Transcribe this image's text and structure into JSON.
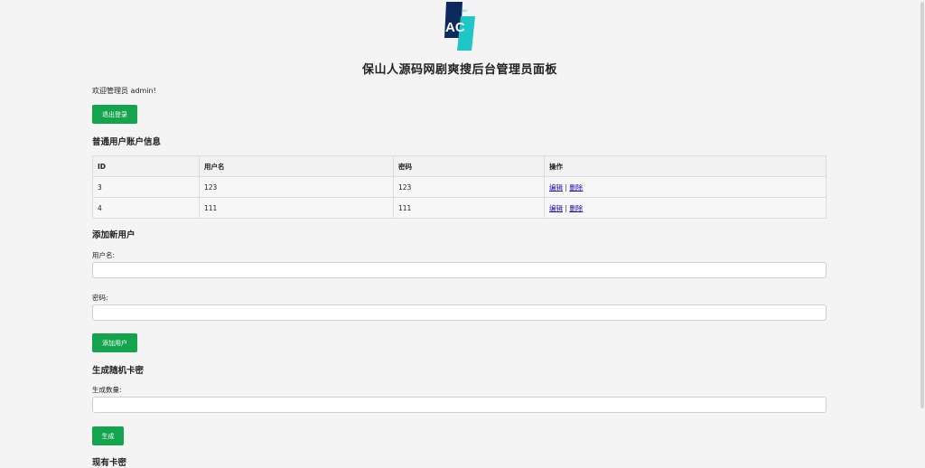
{
  "logo": {
    "text": "AC",
    "small_text": "AC"
  },
  "page_title": "保山人源码网剧爽搜后台管理员面板",
  "welcome": "欢迎管理员 admin!",
  "logout_button": "退出登录",
  "users_section": {
    "title": "普通用户账户信息",
    "columns": [
      "ID",
      "用户名",
      "密码",
      "操作"
    ],
    "rows": [
      {
        "id": "3",
        "username": "123",
        "password": "123",
        "edit": "编辑",
        "sep": "|",
        "delete": "删除"
      },
      {
        "id": "4",
        "username": "111",
        "password": "111",
        "edit": "编辑",
        "sep": "|",
        "delete": "删除"
      }
    ]
  },
  "add_user_section": {
    "title": "添加新用户",
    "username_label": "用户名:",
    "password_label": "密码:",
    "submit_button": "添加用户"
  },
  "generate_section": {
    "title": "生成随机卡密",
    "count_label": "生成数量:",
    "submit_button": "生成"
  },
  "existing_cards_section": {
    "title": "现有卡密"
  },
  "colors": {
    "accent": "#14a44d",
    "link": "#1a0dab",
    "logo_dark": "#0d2a5c",
    "logo_teal": "#1ec6c6"
  }
}
